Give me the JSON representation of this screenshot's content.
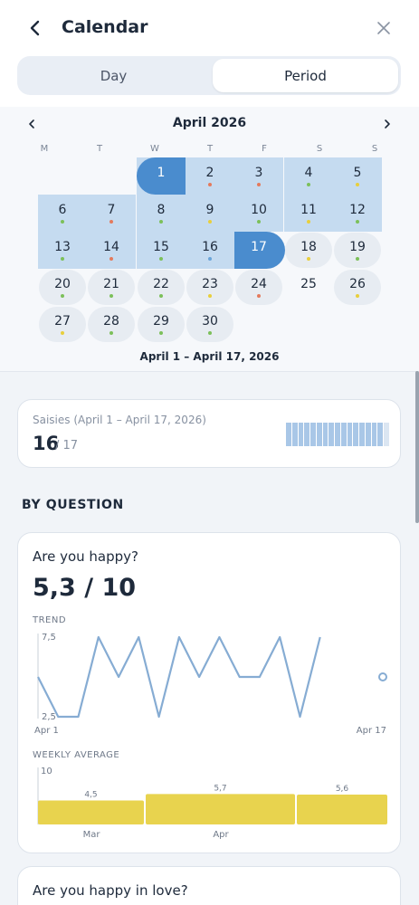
{
  "header": {
    "title": "Calendar",
    "back_icon": "chevron-left-icon",
    "close_icon": "close-icon"
  },
  "tabs": {
    "day": "Day",
    "period": "Period",
    "selected": "Period"
  },
  "calendar": {
    "month": "April 2026",
    "weekdays": [
      "M",
      "T",
      "W",
      "T",
      "F",
      "S",
      "S"
    ],
    "first_weekday_offset": 2,
    "days": [
      {
        "d": "1",
        "dot": "none",
        "state": "start"
      },
      {
        "d": "2",
        "dot": "red",
        "state": "range"
      },
      {
        "d": "3",
        "dot": "red",
        "state": "range"
      },
      {
        "d": "4",
        "dot": "green",
        "state": "range"
      },
      {
        "d": "5",
        "dot": "yellow",
        "state": "range"
      },
      {
        "d": "6",
        "dot": "green",
        "state": "range"
      },
      {
        "d": "7",
        "dot": "red",
        "state": "range"
      },
      {
        "d": "8",
        "dot": "green",
        "state": "range"
      },
      {
        "d": "9",
        "dot": "yellow",
        "state": "range"
      },
      {
        "d": "10",
        "dot": "green",
        "state": "range"
      },
      {
        "d": "11",
        "dot": "yellow",
        "state": "range"
      },
      {
        "d": "12",
        "dot": "green",
        "state": "range"
      },
      {
        "d": "13",
        "dot": "green",
        "state": "range"
      },
      {
        "d": "14",
        "dot": "red",
        "state": "range"
      },
      {
        "d": "15",
        "dot": "green",
        "state": "range"
      },
      {
        "d": "16",
        "dot": "blue",
        "state": "range"
      },
      {
        "d": "17",
        "dot": "none",
        "state": "end"
      },
      {
        "d": "18",
        "dot": "yellow",
        "state": "bubble"
      },
      {
        "d": "19",
        "dot": "green",
        "state": "bubble"
      },
      {
        "d": "20",
        "dot": "green",
        "state": "bubble"
      },
      {
        "d": "21",
        "dot": "green",
        "state": "bubble"
      },
      {
        "d": "22",
        "dot": "green",
        "state": "bubble"
      },
      {
        "d": "23",
        "dot": "yellow",
        "state": "bubble"
      },
      {
        "d": "24",
        "dot": "red",
        "state": "bubble"
      },
      {
        "d": "25",
        "dot": "none",
        "state": "plain"
      },
      {
        "d": "26",
        "dot": "yellow",
        "state": "bubble"
      },
      {
        "d": "27",
        "dot": "yellow",
        "state": "bubble"
      },
      {
        "d": "28",
        "dot": "green",
        "state": "bubble"
      },
      {
        "d": "29",
        "dot": "green",
        "state": "bubble"
      },
      {
        "d": "30",
        "dot": "green",
        "state": "bubble"
      }
    ],
    "dot_colors": {
      "red": "#e47a5c",
      "green": "#7cc05a",
      "yellow": "#e8cf3c",
      "blue": "#6aa4d8"
    },
    "range_label": "April 1 – April 17, 2026"
  },
  "summary": {
    "label": "Saisies (April 1 – April 17, 2026)",
    "count": "16",
    "total": "/ 17",
    "filled": 16,
    "slots": 17
  },
  "section_title": "BY QUESTION",
  "questions": [
    {
      "title": "Are you happy?",
      "score": "5,3 / 10",
      "trend_label": "TREND",
      "weekly_label": "WEEKLY AVERAGE"
    },
    {
      "title": "Are you happy in love?"
    }
  ],
  "chart_data": [
    {
      "type": "line",
      "title": "TREND",
      "ylim": [
        2.5,
        7.5
      ],
      "y_ticks": [
        "7,5",
        "2,5"
      ],
      "x_tick_labels": [
        "Apr 1",
        "Apr 17"
      ],
      "x": [
        1,
        2,
        3,
        4,
        5,
        6,
        7,
        8,
        9,
        10,
        11,
        12,
        13,
        14,
        15,
        16
      ],
      "values": [
        5,
        2.5,
        2.5,
        7.5,
        5,
        7.5,
        2.5,
        7.5,
        5,
        7.5,
        5,
        5,
        7.5,
        2.5,
        7.5,
        null
      ],
      "open_point": {
        "x": 17,
        "value": 5
      },
      "color": "#86acd3"
    },
    {
      "type": "bar",
      "title": "WEEKLY AVERAGE",
      "ylim": [
        0,
        10
      ],
      "y_ticks": [
        "10"
      ],
      "categories": [
        "Mar",
        "Apr",
        ""
      ],
      "values": [
        4.5,
        5.7,
        5.6
      ],
      "value_labels": [
        "4,5",
        "5,7",
        "5,6"
      ],
      "color": "#e8d34e"
    }
  ]
}
